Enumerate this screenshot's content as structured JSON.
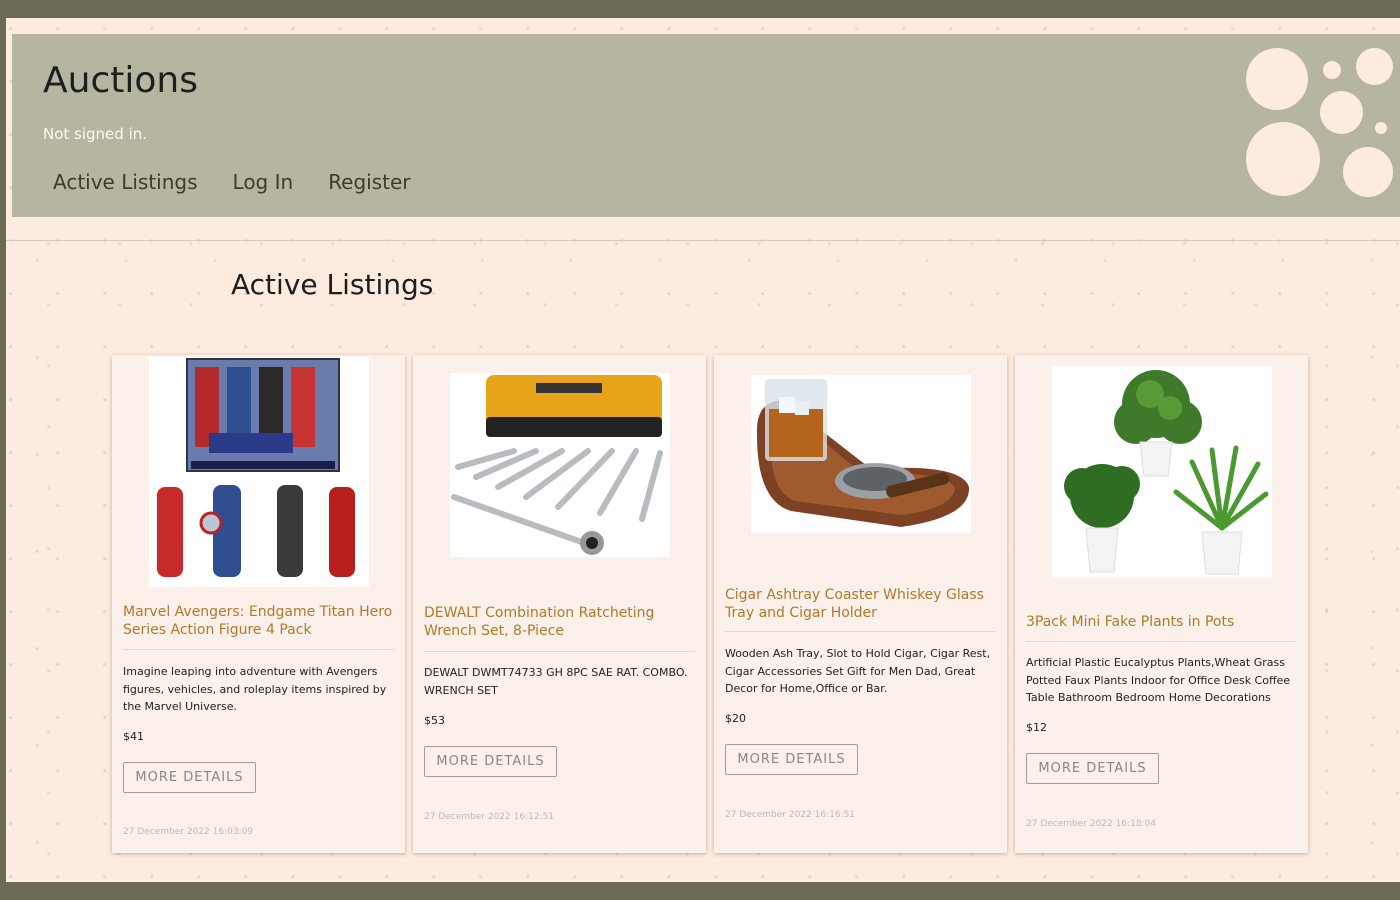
{
  "header": {
    "title": "Auctions",
    "sign_status": "Not signed in.",
    "nav": [
      "Active Listings",
      "Log In",
      "Register"
    ]
  },
  "main": {
    "heading": "Active Listings",
    "button_label": "MORE DETAILS",
    "listings": [
      {
        "title": "Marvel Avengers: Endgame Titan Hero Series Action Figure 4 Pack",
        "description": "Imagine leaping into adventure with Avengers figures, vehicles, and roleplay items inspired by the Marvel Universe.",
        "price": "$41",
        "date": "27 December 2022 16:03:09",
        "image": "action-figures-image"
      },
      {
        "title": "DEWALT Combination Ratcheting Wrench Set, 8-Piece",
        "description": "DEWALT DWMT74733 GH 8PC SAE RAT. COMBO. WRENCH SET",
        "price": "$53",
        "date": "27 December 2022 16:12:51",
        "image": "wrench-set-image"
      },
      {
        "title": "Cigar Ashtray Coaster Whiskey Glass Tray and Cigar Holder",
        "description": "Wooden Ash Tray, Slot to Hold Cigar, Cigar Rest, Cigar Accessories Set Gift for Men Dad, Great Decor for Home,Office or Bar.",
        "price": "$20",
        "date": "27 December 2022 16:16:51",
        "image": "whiskey-tray-image"
      },
      {
        "title": "3Pack Mini Fake Plants in Pots",
        "description": "Artificial Plastic Eucalyptus Plants,Wheat Grass Potted Faux Plants Indoor for Office Desk Coffee Table Bathroom Bedroom Home Decorations",
        "price": "$12",
        "date": "27 December 2022 16:18:04",
        "image": "potted-plants-image"
      }
    ]
  },
  "colors": {
    "frame": "#6b6a52",
    "page_bg": "#fdebdf",
    "header_bg": "#b6b5a0",
    "card_bg": "#fbf0ea",
    "title_link": "#b07a2a"
  }
}
